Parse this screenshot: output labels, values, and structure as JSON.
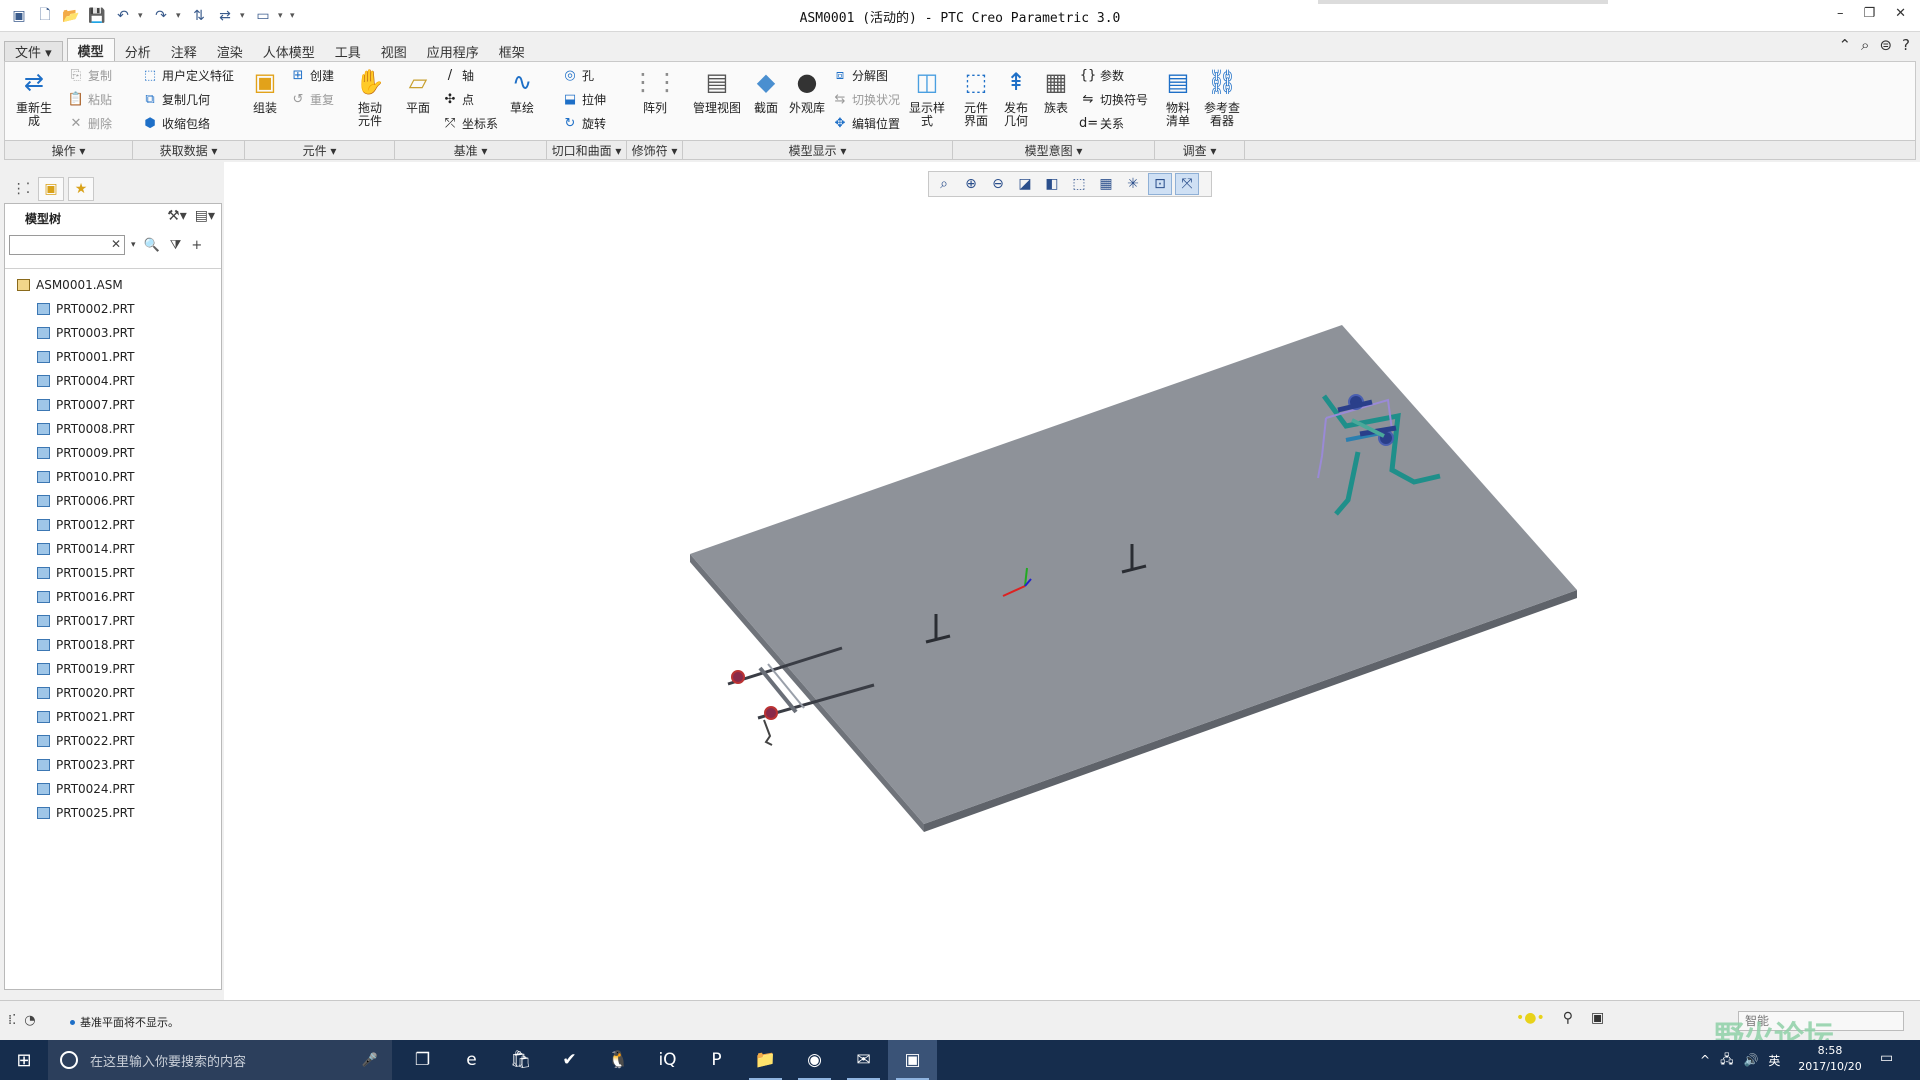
{
  "window": {
    "title": "ASM0001 (活动的) - PTC Creo Parametric 3.0",
    "controls": [
      "–",
      "❐",
      "✕"
    ]
  },
  "quick_access": [
    "▣",
    "🗋",
    "📂",
    "💾",
    "↶",
    "▾",
    "↷",
    "▾",
    "⇅",
    "⇄",
    "▾",
    "▭",
    "▾",
    "▾"
  ],
  "tabs": [
    "文件 ▾",
    "模型",
    "分析",
    "注释",
    "渲染",
    "人体模型",
    "工具",
    "视图",
    "应用程序",
    "框架"
  ],
  "active_tab": "模型",
  "ribbon": {
    "regen": "重新生成",
    "copy": "复制",
    "paste": "粘贴",
    "delete": "删除",
    "udf": "用户定义特征",
    "copy_geom": "复制几何",
    "shrinkwrap": "收缩包络",
    "assemble": "组装",
    "create": "创建",
    "repeat": "重复",
    "drag": "拖动\n元件",
    "plane": "平面",
    "axis": "轴",
    "point": "点",
    "csys": "坐标系",
    "sketch": "草绘",
    "hole": "孔",
    "extrude": "拉伸",
    "revolve": "旋转",
    "pattern": "阵列",
    "manage_views": "管理视图",
    "section": "截面",
    "appearance": "外观库",
    "explode": "分解图",
    "toggle_status": "切换状况",
    "edit_position": "编辑位置",
    "display_style": "显示样\n式",
    "comp_interface": "元件\n界面",
    "publish_geom": "发布\n几何",
    "family_table": "族表",
    "params": "参数",
    "switch_symbols": "切换符号",
    "relations": "关系",
    "bom": "物料\n清单",
    "ref_viewer": "参考查\n看器"
  },
  "ribbon_groups": [
    "操作 ▾",
    "获取数据 ▾",
    "元件 ▾",
    "基准 ▾",
    "切口和曲面 ▾",
    "修饰符 ▾",
    "模型显示 ▾",
    "模型意图 ▾",
    "调查 ▾"
  ],
  "graphics_toolbar": [
    "⌕",
    "⊕",
    "⊖",
    "◪",
    "◧",
    "⬚",
    "▦",
    "✳",
    "⊡",
    "⤧"
  ],
  "model_tree": {
    "title": "模型树",
    "search_placeholder": "",
    "root": "ASM0001.ASM",
    "parts": [
      "PRT0002.PRT",
      "PRT0003.PRT",
      "PRT0001.PRT",
      "PRT0004.PRT",
      "PRT0007.PRT",
      "PRT0008.PRT",
      "PRT0009.PRT",
      "PRT0010.PRT",
      "PRT0006.PRT",
      "PRT0012.PRT",
      "PRT0014.PRT",
      "PRT0015.PRT",
      "PRT0016.PRT",
      "PRT0017.PRT",
      "PRT0018.PRT",
      "PRT0019.PRT",
      "PRT0020.PRT",
      "PRT0021.PRT",
      "PRT0022.PRT",
      "PRT0023.PRT",
      "PRT0024.PRT",
      "PRT0025.PRT"
    ]
  },
  "status": {
    "message": "基准平面将不显示。",
    "filter": "智能"
  },
  "watermark": "野火论坛",
  "taskbar": {
    "search_placeholder": "在这里输入你要搜索的内容",
    "apps": [
      "❐",
      "e",
      "🛍",
      "✔",
      "🐧",
      "iQ",
      "P",
      "📁",
      "◉",
      "✉",
      "▣"
    ],
    "tray": [
      "^",
      "🖧",
      "🔊",
      "英"
    ],
    "time": "8:58",
    "date": "2017/10/20"
  },
  "colors": {
    "plate_top": "#8e9299",
    "plate_side": "#6f737a",
    "accent_blue": "#1e6fc7",
    "teal_part": "#1f8f8a",
    "taskbar_bg": "#162d4d"
  }
}
